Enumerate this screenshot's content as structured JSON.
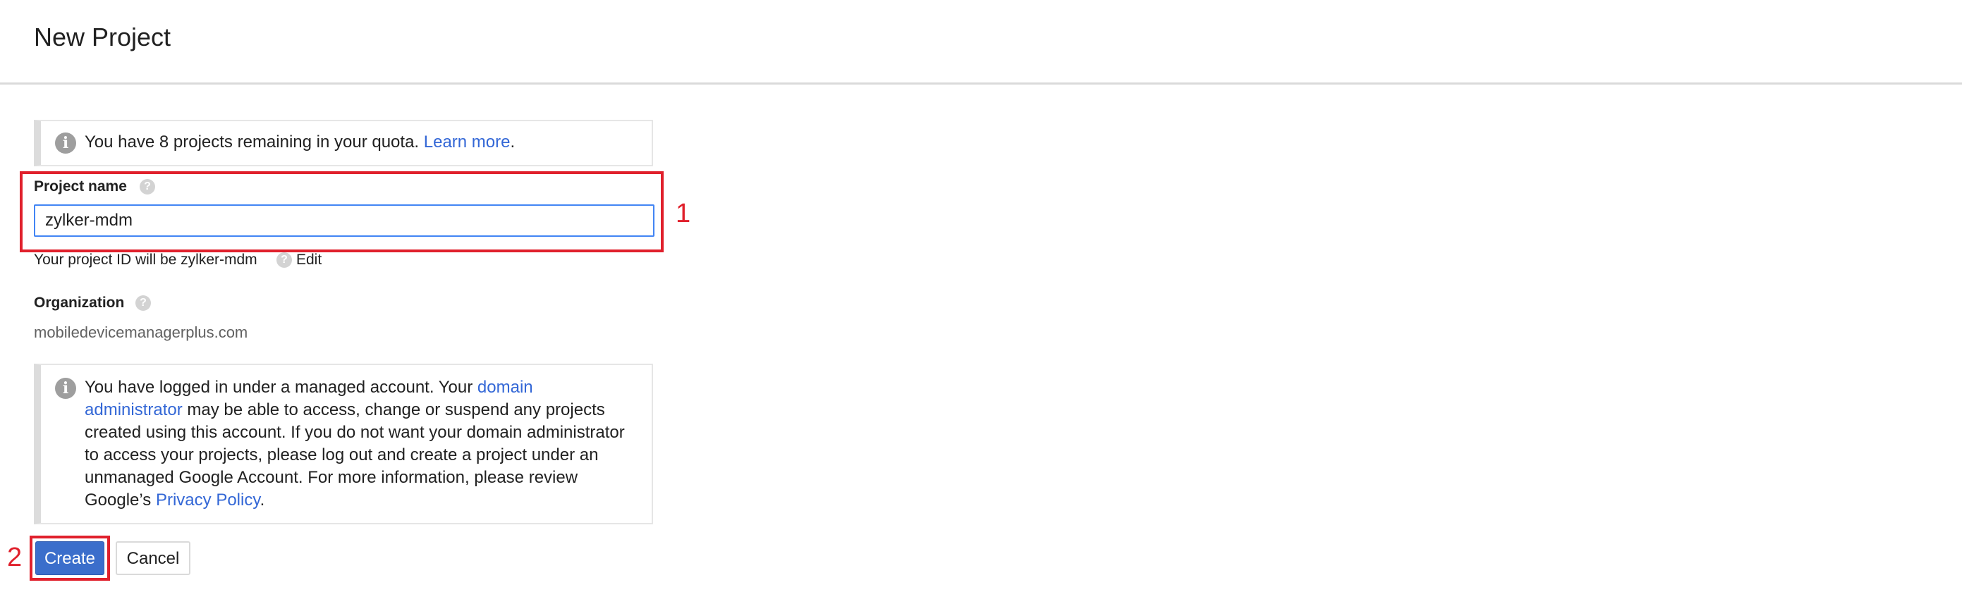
{
  "header": {
    "title": "New Project"
  },
  "quota_notice": {
    "icon": "info-icon",
    "text": "You have 8 projects remaining in your quota. ",
    "link": "Learn more",
    "suffix": "."
  },
  "project_name": {
    "label": "Project name",
    "value": "zylker-mdm",
    "help_icon": "help-icon"
  },
  "project_id": {
    "text": "Your project ID will be zylker-mdm",
    "edit_link": "Edit"
  },
  "organization": {
    "label": "Organization",
    "value": "mobiledevicemanagerplus.com"
  },
  "managed_notice": {
    "icon": "info-icon",
    "line1_pre": "You have logged in under a managed account. Your ",
    "line1_link": "domain",
    "line2_link": "administrator",
    "line2_post": " may be able to access, change or suspend any projects",
    "line3": "created using this account. If you do not want your domain administrator",
    "line4": "to access your projects, please log out and create a project under an",
    "line5": "unmanaged Google Account. For more information, please review",
    "line6_pre": "Google’s ",
    "line6_link": "Privacy Policy",
    "line6_post": "."
  },
  "buttons": {
    "create": "Create",
    "cancel": "Cancel"
  },
  "annotations": {
    "step1": "1",
    "step2": "2",
    "color": "#e0202c"
  },
  "colors": {
    "link": "#3367d6",
    "primary_button": "#3b6ecb",
    "focus_border": "#4285f4"
  }
}
